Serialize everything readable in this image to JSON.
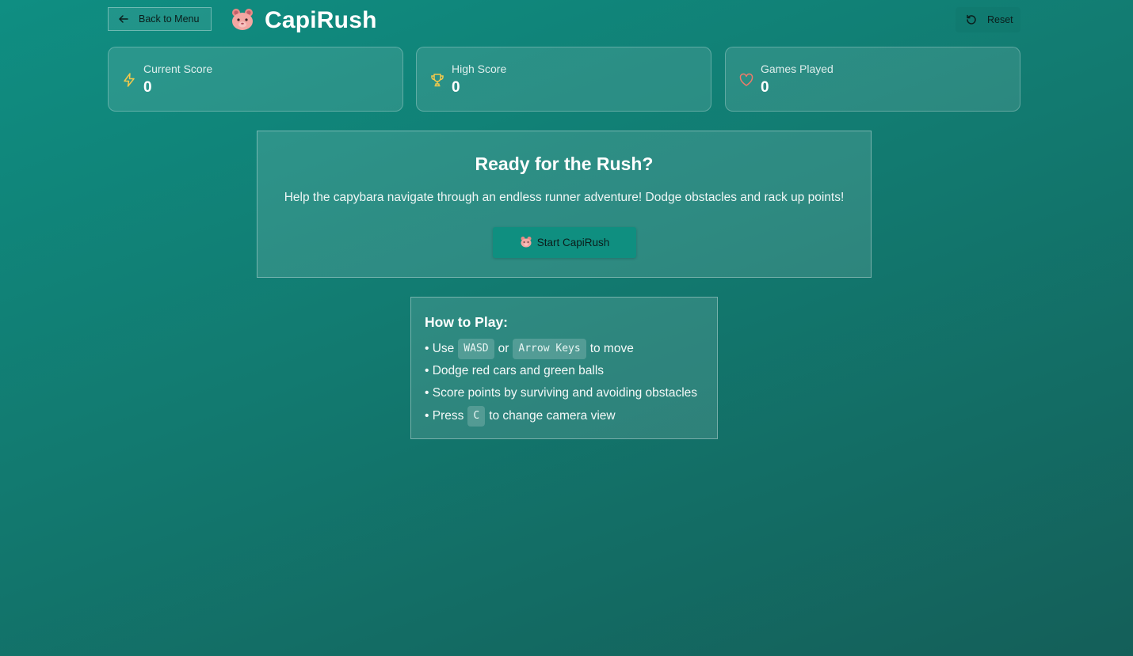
{
  "header": {
    "back_label": "Back to Menu",
    "title": "CapiRush",
    "reset_label": "Reset"
  },
  "stats": [
    {
      "label": "Current Score",
      "value": "0",
      "icon": "lightning-icon",
      "color": "#f2c94c"
    },
    {
      "label": "High Score",
      "value": "0",
      "icon": "trophy-icon",
      "color": "#f2c94c"
    },
    {
      "label": "Games Played",
      "value": "0",
      "icon": "heart-icon",
      "color": "#f07a6a"
    }
  ],
  "ready": {
    "title": "Ready for the Rush?",
    "description": "Help the capybara navigate through an endless runner adventure! Dodge obstacles and rack up points!",
    "start_label": "Start CapiRush"
  },
  "howto": {
    "title": "How to Play:",
    "line1": {
      "prefix": "• Use",
      "key1": "WASD",
      "mid": "or",
      "key2": "Arrow Keys",
      "suffix": "to move"
    },
    "line2": "• Dodge red cars and green balls",
    "line3": "• Score points by surviving and avoiding obstacles",
    "line4": {
      "prefix": "• Press",
      "key": "C",
      "suffix": "to change camera view"
    }
  },
  "colors": {
    "accent": "#0f8f80",
    "background_top": "#0f8e82",
    "background_bottom": "#145f59"
  }
}
